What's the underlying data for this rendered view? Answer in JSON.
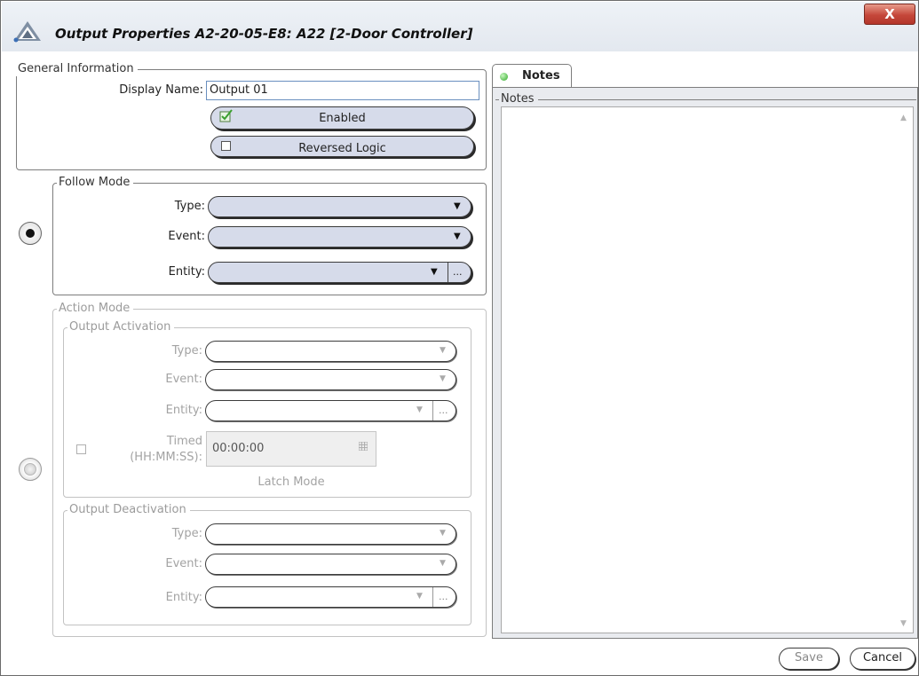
{
  "window": {
    "title": "Output Properties  A2-20-05-E8: A22 [2-Door Controller]",
    "close_label": "X"
  },
  "general": {
    "legend": "General Information",
    "display_name_label": "Display Name:",
    "display_name_value": "Output 01",
    "enabled_label": "Enabled",
    "enabled_checked": true,
    "reversed_label": "Reversed Logic",
    "reversed_checked": false
  },
  "follow_mode": {
    "legend": "Follow Mode",
    "selected": true,
    "type_label": "Type:",
    "event_label": "Event:",
    "entity_label": "Entity:",
    "browse_label": "..."
  },
  "action_mode": {
    "legend": "Action Mode",
    "selected": false,
    "activation": {
      "legend": "Output Activation",
      "type_label": "Type:",
      "event_label": "Event:",
      "entity_label": "Entity:",
      "browse_label": "...",
      "timed_label_1": "Timed",
      "timed_label_2": "(HH:MM:SS):",
      "timed_value": "00:00:00",
      "latch_label": "Latch Mode"
    },
    "deactivation": {
      "legend": "Output Deactivation",
      "type_label": "Type:",
      "event_label": "Event:",
      "entity_label": "Entity:",
      "browse_label": "..."
    }
  },
  "notes": {
    "tab_label": "Notes",
    "legend": "Notes",
    "text": ""
  },
  "footer": {
    "save_label": "Save",
    "cancel_label": "Cancel"
  },
  "colors": {
    "pill_fill": "#d6dbea",
    "close_button": "#c5473a",
    "notes_background": "#e9ebef",
    "indicator_green": "#2fa928"
  }
}
